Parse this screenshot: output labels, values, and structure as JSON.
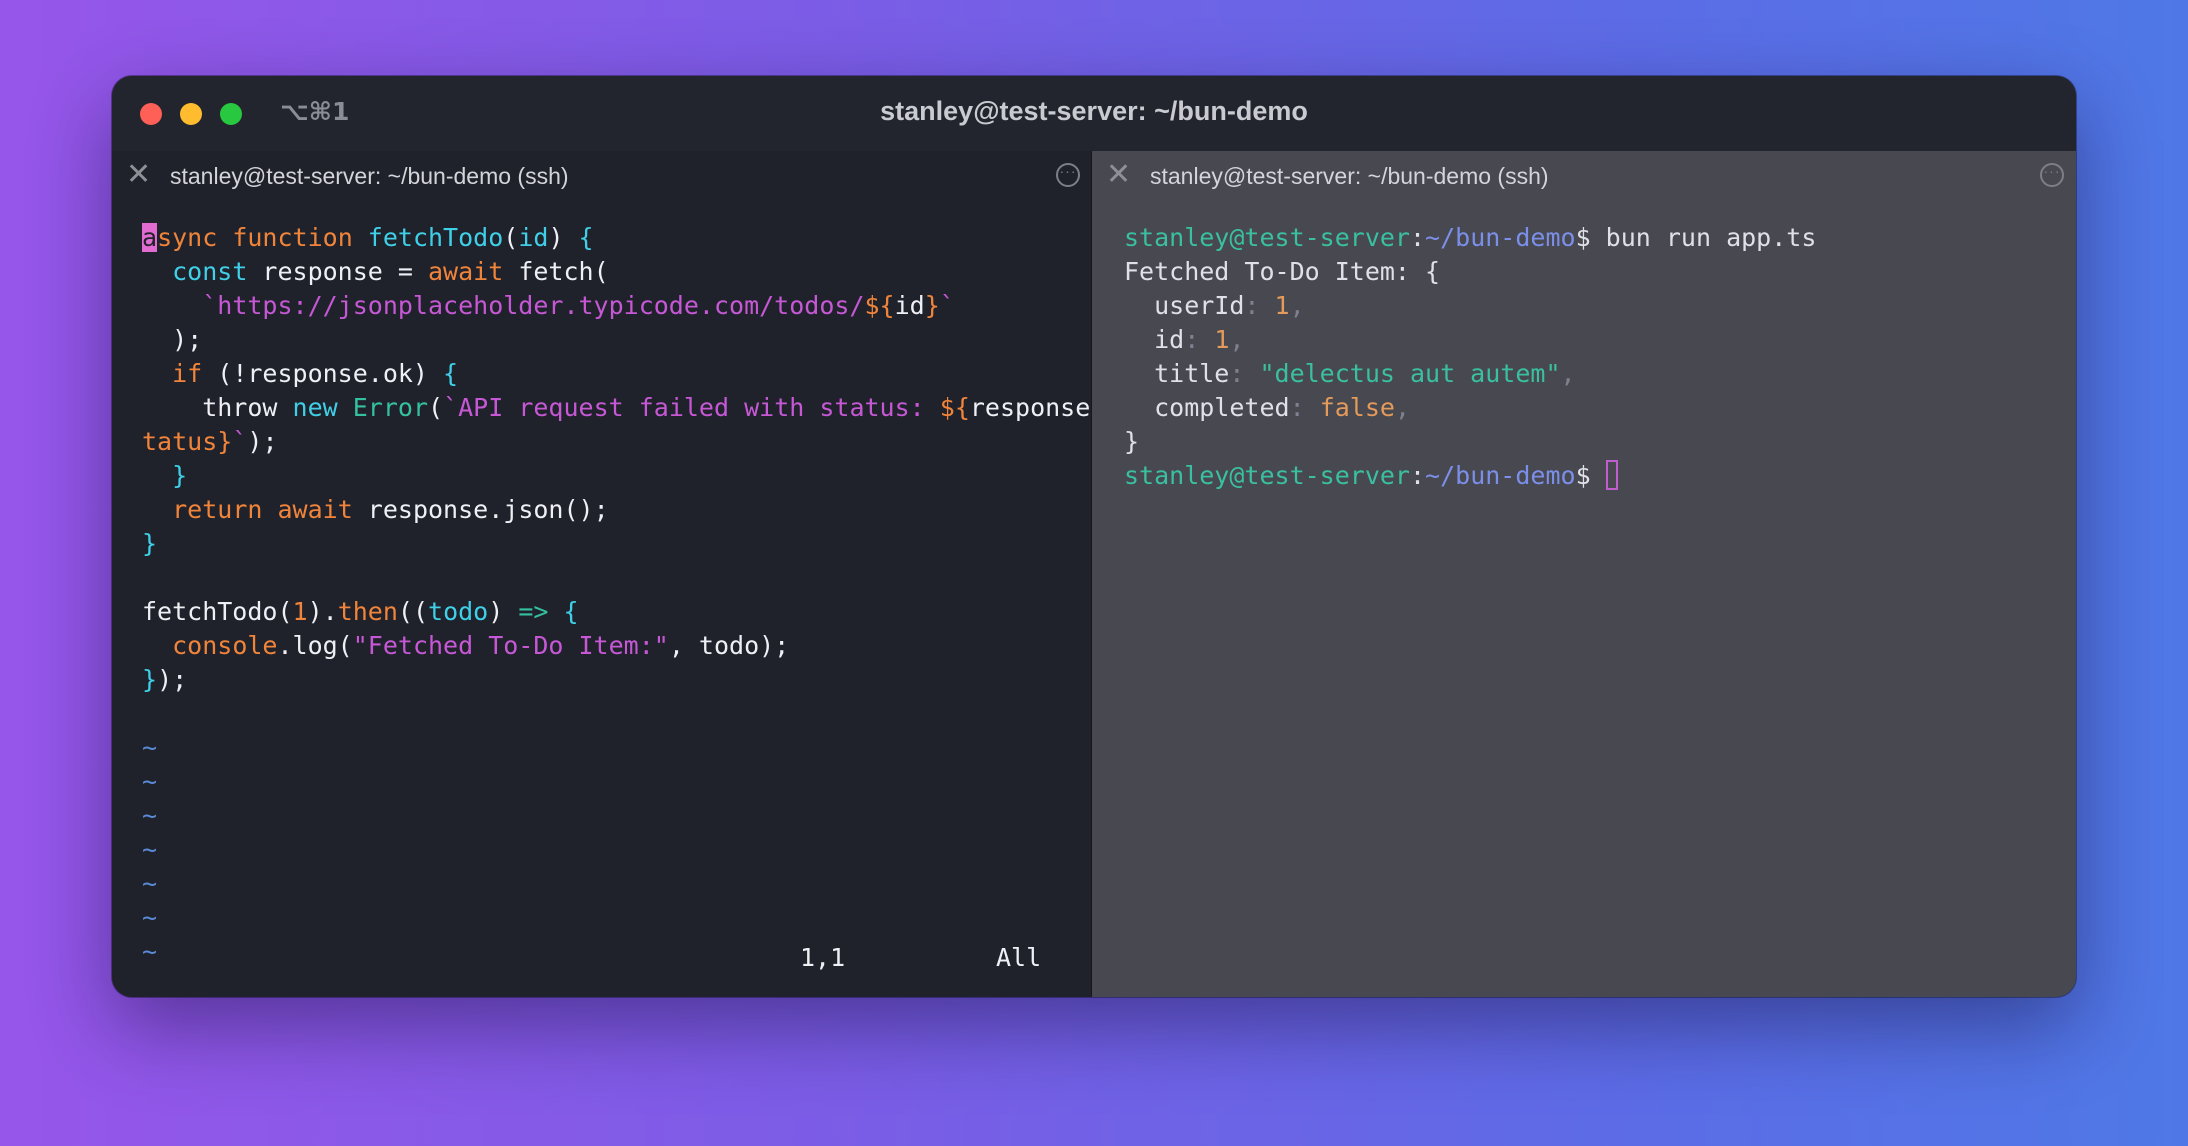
{
  "window": {
    "shortcut": "⌥⌘1",
    "title": "stanley@test-server: ~/bun-demo"
  },
  "left_pane": {
    "tab_title": "stanley@test-server: ~/bun-demo (ssh)",
    "close_glyph": "✕",
    "menu_glyph": "···",
    "code": {
      "l1_a": "a",
      "l1_b": "sync",
      "l1_c": " function ",
      "l1_d": "fetchTodo",
      "l1_e": "(",
      "l1_f": "id",
      "l1_g": ") ",
      "l1_h": "{",
      "l2_a": "  ",
      "l2_b": "const",
      "l2_c": " response = ",
      "l2_d": "await",
      "l2_e": " fetch(",
      "l3_a": "    ",
      "l3_b": "`https://jsonplaceholder.typicode.com/todos/",
      "l3_c": "${",
      "l3_d": "id",
      "l3_e": "}",
      "l3_f": "`",
      "l4": "  );",
      "l5_a": "  ",
      "l5_b": "if",
      "l5_c": " (!response.ok) ",
      "l5_d": "{",
      "l6_a": "    throw ",
      "l6_b": "new",
      "l6_c": " ",
      "l6_d": "Error",
      "l6_e": "(",
      "l6_f": "`API request failed with status: ",
      "l6_g": "${",
      "l6_h": "response.s",
      "l7_a": "tatus",
      "l7_b": "}",
      "l7_c": "`",
      "l7_d": ");",
      "l8_a": "  ",
      "l8_b": "}",
      "l9_a": "  ",
      "l9_b": "return",
      "l9_c": " ",
      "l9_d": "await",
      "l9_e": " response.json();",
      "l10": "}",
      "l12_a": "fetchTodo(",
      "l12_b": "1",
      "l12_c": ").",
      "l12_d": "then",
      "l12_e": "((",
      "l12_f": "todo",
      "l12_g": ") ",
      "l12_h": "=>",
      "l12_i": " ",
      "l12_j": "{",
      "l13_a": "  ",
      "l13_b": "console",
      "l13_c": ".log(",
      "l13_d": "\"Fetched To-Do Item:\"",
      "l13_e": ", todo);",
      "l14_a": "}",
      "l14_b": ");",
      "tilde": "~"
    },
    "status_position": "1,1",
    "status_scroll": "All"
  },
  "right_pane": {
    "tab_title": "stanley@test-server: ~/bun-demo (ssh)",
    "close_glyph": "✕",
    "menu_glyph": "···",
    "prompt_user": "stanley@test-server",
    "prompt_colon": ":",
    "prompt_path": "~/bun-demo",
    "prompt_dollar": "$ ",
    "command": "bun run app.ts",
    "out_header": "Fetched To-Do Item: {",
    "fields": [
      {
        "key": "  userId",
        "sep": ": ",
        "value": "1",
        "comma": ","
      },
      {
        "key": "  id",
        "sep": ": ",
        "value": "1",
        "comma": ","
      },
      {
        "key": "  title",
        "sep": ": ",
        "value": "\"delectus aut autem\"",
        "comma": ","
      },
      {
        "key": "  completed",
        "sep": ": ",
        "value": "false",
        "comma": ","
      }
    ],
    "out_close": "}"
  },
  "colors": {
    "bg_gradient_start": "#9656e9",
    "bg_gradient_end": "#4f78e6",
    "left_bg": "#20222b",
    "right_bg": "#474850",
    "keyword_orange": "#f0843a",
    "keyword_cyan": "#3fd0e8",
    "string_purple": "#c658d6",
    "prompt_green": "#3ac0a0",
    "path_blue": "#7c8fe8",
    "cursor_pink": "#e26bd2"
  },
  "icons": {
    "traffic_lights": [
      "close-window-icon",
      "minimize-window-icon",
      "zoom-window-icon"
    ],
    "tab_close": "close-icon",
    "tab_menu": "more-options-icon"
  }
}
